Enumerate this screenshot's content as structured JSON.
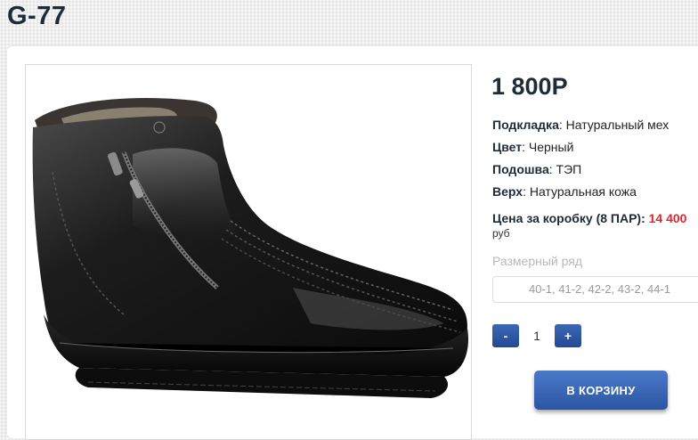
{
  "product": {
    "title": "G-77",
    "price": "1 800Р",
    "image_alt": "black leather winter ankle boot with side zipper and fur lining"
  },
  "specs": [
    {
      "label": "Подкладка",
      "value": ": Натуральный мех"
    },
    {
      "label": "Цвет",
      "value": ": Черный"
    },
    {
      "label": "Подошва",
      "value": ": ТЭП"
    },
    {
      "label": "Верх",
      "value": ": Натуральная кожа"
    }
  ],
  "box_price": {
    "label": "Цена за коробку (8 ПАР):",
    "value": "14 400",
    "unit": "руб"
  },
  "size": {
    "label": "Размерный ряд",
    "selected": "40-1, 41-2, 42-2, 43-2, 44-1"
  },
  "quantity": {
    "minus_label": "-",
    "value": "1",
    "plus_label": "+"
  },
  "cart": {
    "button_label": "В КОРЗИНУ"
  },
  "colors": {
    "accent": "#2a55a3",
    "price_red": "#e8232a",
    "title": "#1f2a3a"
  }
}
